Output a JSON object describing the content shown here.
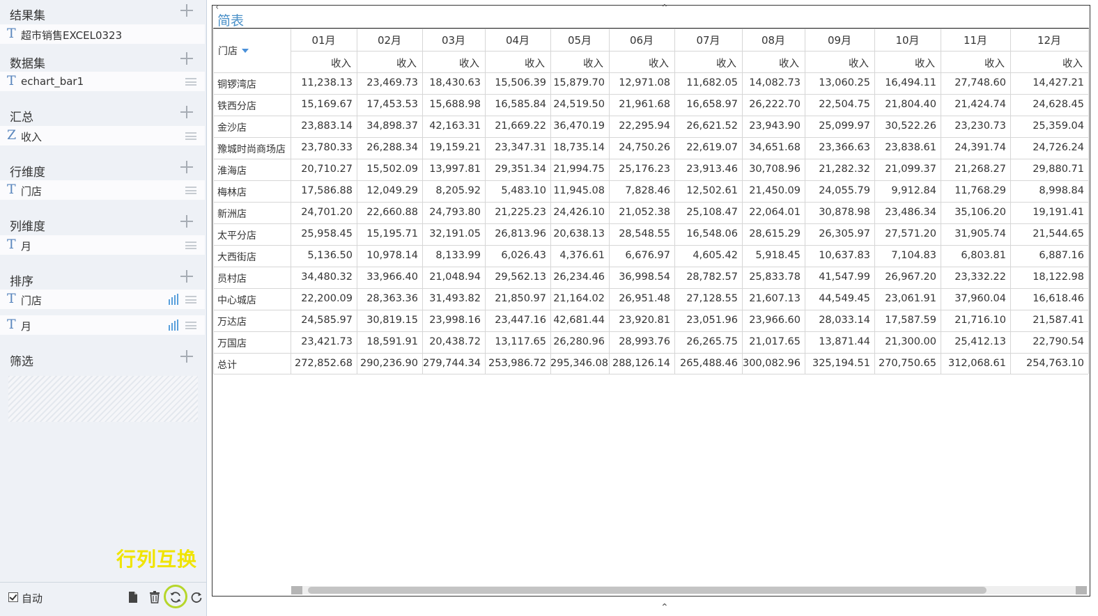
{
  "sidebar": {
    "sections": [
      {
        "title": "结果集",
        "fields": [
          {
            "type": "T",
            "label": "超市销售EXCEL0323"
          }
        ]
      },
      {
        "title": "数据集",
        "fields": [
          {
            "type": "T",
            "label": "echart_bar1"
          }
        ]
      },
      {
        "title": "汇总",
        "fields": [
          {
            "type": "Z",
            "label": "收入"
          }
        ]
      },
      {
        "title": "行维度",
        "fields": [
          {
            "type": "T",
            "label": "门店"
          }
        ]
      },
      {
        "title": "列维度",
        "fields": [
          {
            "type": "T",
            "label": "月"
          }
        ]
      },
      {
        "title": "排序",
        "fields": [
          {
            "type": "T",
            "label": "门店"
          },
          {
            "type": "T",
            "label": "月"
          }
        ]
      },
      {
        "title": "筛选",
        "fields": []
      }
    ],
    "swap_label": "行列互换",
    "auto_label": "自动",
    "auto_checked": true,
    "toolbar_icons": [
      "file-icon",
      "trash-icon",
      "swap-rows-cols-icon",
      "refresh-icon"
    ]
  },
  "table": {
    "title": "简表",
    "row_header": "门店",
    "months": [
      "01月",
      "02月",
      "03月",
      "04月",
      "05月",
      "06月",
      "07月",
      "08月",
      "09月",
      "10月",
      "11月",
      "12月"
    ],
    "measure": "收入",
    "rows": [
      {
        "store": "铜锣湾店",
        "values": [
          "11,238.13",
          "23,469.73",
          "18,430.63",
          "15,506.39",
          "15,879.70",
          "12,971.08",
          "11,682.05",
          "14,082.73",
          "13,060.25",
          "16,494.11",
          "27,748.60",
          "14,427.21"
        ]
      },
      {
        "store": "铁西分店",
        "values": [
          "15,169.67",
          "17,453.53",
          "15,688.98",
          "16,585.84",
          "24,519.50",
          "21,961.68",
          "16,658.97",
          "26,222.70",
          "22,504.75",
          "21,804.40",
          "21,424.74",
          "24,628.45"
        ]
      },
      {
        "store": "金沙店",
        "values": [
          "23,883.14",
          "34,898.37",
          "42,163.31",
          "21,669.22",
          "36,470.19",
          "22,295.94",
          "26,621.52",
          "23,943.90",
          "25,099.97",
          "30,522.26",
          "23,230.73",
          "25,359.04"
        ]
      },
      {
        "store": "豫城时尚商场店",
        "values": [
          "23,780.33",
          "26,288.34",
          "19,159.21",
          "23,347.31",
          "18,735.14",
          "24,750.26",
          "22,619.07",
          "34,651.68",
          "23,366.63",
          "23,838.61",
          "24,391.74",
          "24,726.24"
        ]
      },
      {
        "store": "淮海店",
        "values": [
          "20,710.27",
          "15,502.09",
          "13,997.81",
          "29,351.34",
          "21,994.75",
          "25,176.23",
          "23,913.46",
          "30,708.96",
          "21,282.32",
          "21,099.37",
          "21,268.27",
          "29,880.71"
        ]
      },
      {
        "store": "梅林店",
        "values": [
          "17,586.88",
          "12,049.29",
          "8,205.92",
          "5,483.10",
          "11,945.08",
          "7,828.46",
          "12,502.61",
          "21,450.09",
          "24,055.79",
          "9,912.84",
          "11,768.29",
          "8,998.84"
        ]
      },
      {
        "store": "新洲店",
        "values": [
          "24,701.20",
          "22,660.88",
          "24,793.80",
          "21,225.23",
          "24,426.10",
          "21,052.38",
          "25,108.47",
          "22,064.01",
          "30,878.98",
          "23,486.34",
          "35,106.20",
          "19,191.41"
        ]
      },
      {
        "store": "太平分店",
        "values": [
          "25,958.45",
          "15,195.71",
          "32,191.05",
          "26,813.96",
          "20,638.13",
          "28,548.55",
          "16,548.06",
          "28,615.29",
          "26,305.97",
          "27,571.20",
          "31,905.74",
          "21,544.65"
        ]
      },
      {
        "store": "大西街店",
        "values": [
          "5,136.50",
          "10,978.14",
          "8,133.99",
          "6,026.43",
          "4,376.61",
          "6,676.97",
          "4,605.42",
          "5,918.45",
          "10,637.83",
          "7,104.83",
          "6,803.81",
          "6,887.16"
        ]
      },
      {
        "store": "员村店",
        "values": [
          "34,480.32",
          "33,966.40",
          "21,048.94",
          "29,562.13",
          "26,234.46",
          "36,998.54",
          "28,782.57",
          "25,833.78",
          "41,547.99",
          "26,967.20",
          "23,332.22",
          "18,122.98"
        ]
      },
      {
        "store": "中心城店",
        "values": [
          "22,200.09",
          "28,363.36",
          "31,493.82",
          "21,850.97",
          "21,164.02",
          "26,951.48",
          "27,128.55",
          "21,607.13",
          "44,549.45",
          "23,061.91",
          "37,960.04",
          "16,618.46"
        ]
      },
      {
        "store": "万达店",
        "values": [
          "24,585.97",
          "30,819.15",
          "23,998.16",
          "23,447.16",
          "42,681.44",
          "23,920.81",
          "23,051.96",
          "23,966.60",
          "28,033.14",
          "17,587.59",
          "21,716.10",
          "21,587.41"
        ]
      },
      {
        "store": "万国店",
        "values": [
          "23,421.73",
          "18,591.91",
          "20,438.72",
          "13,117.65",
          "26,280.96",
          "28,993.76",
          "26,265.75",
          "21,017.65",
          "13,871.44",
          "21,300.00",
          "25,412.13",
          "22,790.54"
        ]
      },
      {
        "store": "总计",
        "values": [
          "272,852.68",
          "290,236.90",
          "279,744.34",
          "253,986.72",
          "295,346.08",
          "288,126.14",
          "265,488.46",
          "300,082.96",
          "325,194.51",
          "270,750.65",
          "312,068.61",
          "254,763.10"
        ]
      }
    ]
  }
}
